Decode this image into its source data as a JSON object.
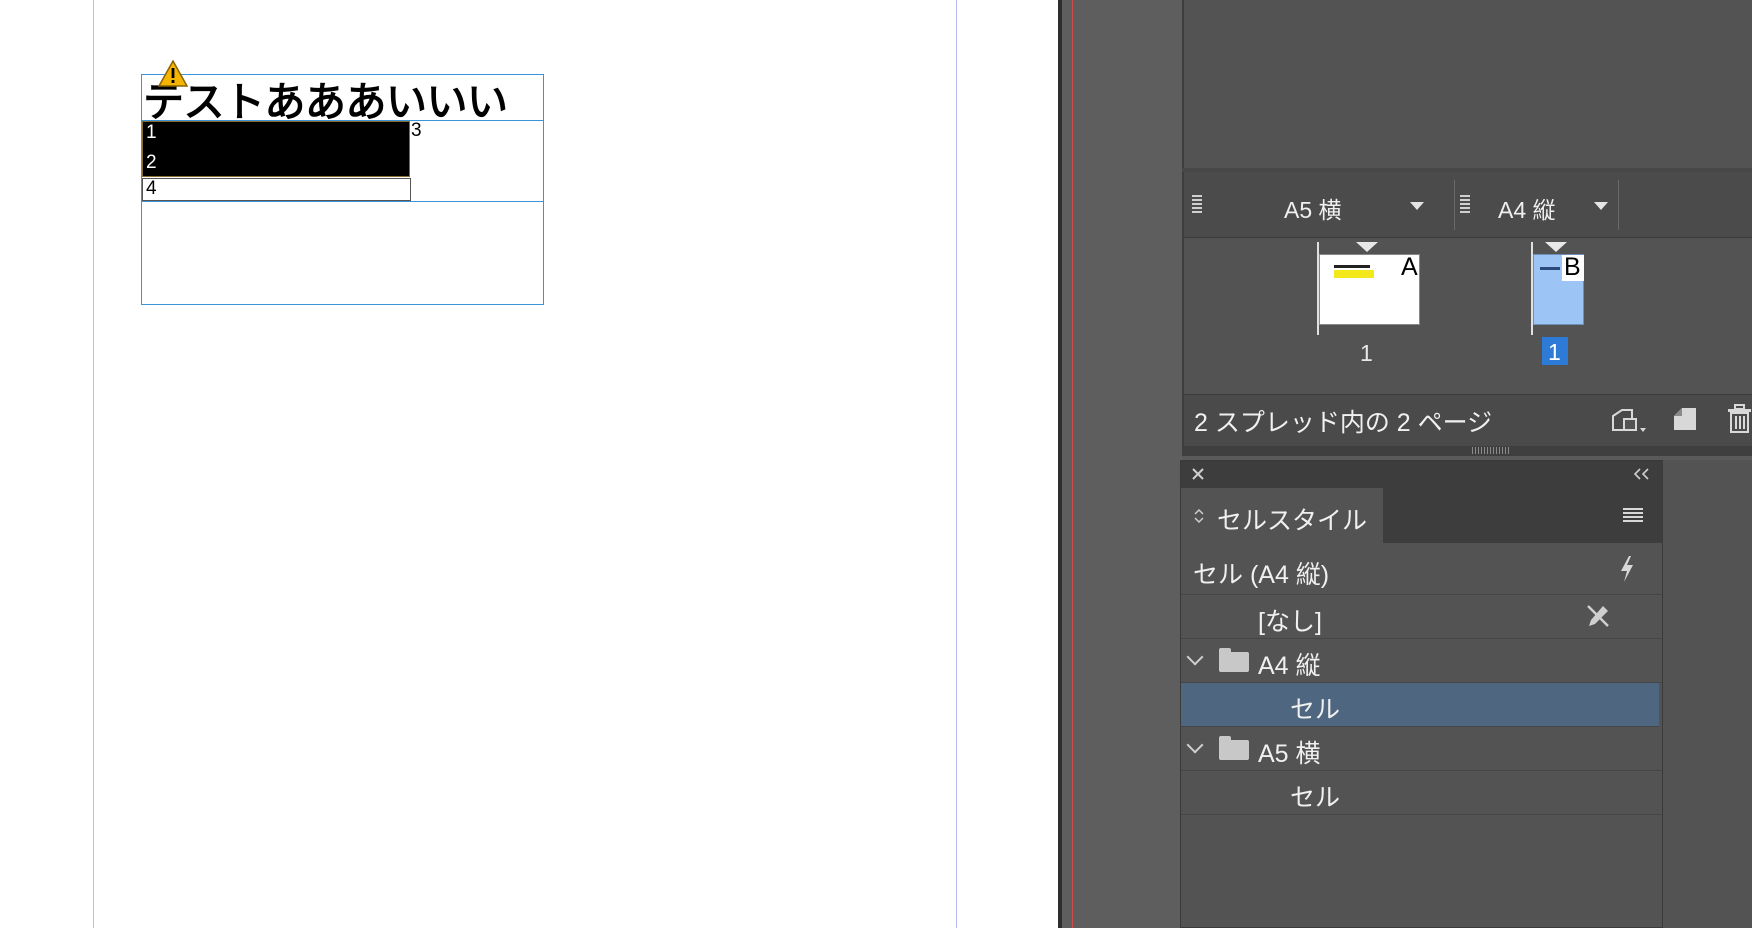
{
  "document": {
    "frame_title": "テストあああいいい",
    "cells": {
      "c1": "1",
      "c2": "2",
      "c3": "3",
      "c4": "4"
    }
  },
  "pages_panel": {
    "masters": [
      {
        "label": "A5 横"
      },
      {
        "label": "A4 縦"
      }
    ],
    "thumbnails": [
      {
        "letter": "A",
        "page_number": "1",
        "selected": false
      },
      {
        "letter": "B",
        "page_number": "1",
        "selected": true
      }
    ],
    "status": "2 スプレッド内の 2 ページ",
    "icons": [
      "new-page-size-icon",
      "new-page-icon",
      "trash-icon"
    ]
  },
  "cell_styles_panel": {
    "tab_label": "セルスタイル",
    "current": "セル (A4 縦)",
    "items": [
      {
        "label": "[なし]",
        "type": "style",
        "level": 1
      },
      {
        "label": "A4 縦",
        "type": "group",
        "level": 0
      },
      {
        "label": "セル",
        "type": "style",
        "level": 2,
        "selected": true
      },
      {
        "label": "A5 横",
        "type": "group",
        "level": 0
      },
      {
        "label": "セル",
        "type": "style",
        "level": 2
      }
    ],
    "colors": {
      "selected_row": "#4e6680",
      "panel_bg": "#535353"
    }
  }
}
